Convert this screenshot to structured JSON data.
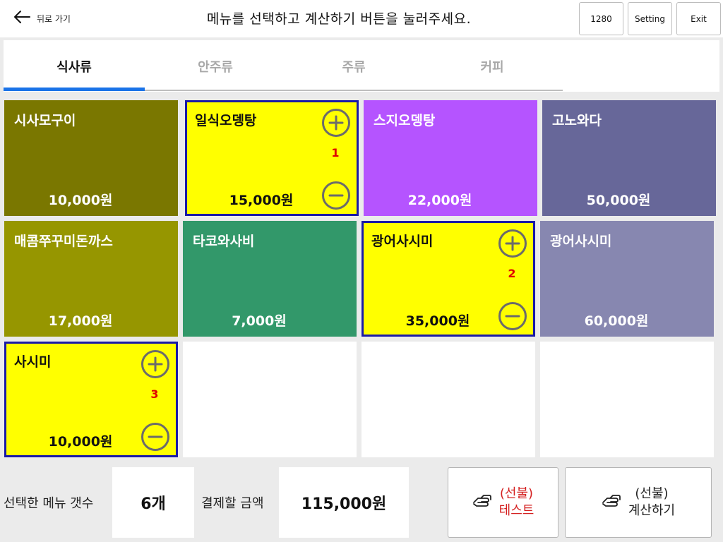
{
  "header": {
    "back_label": "뒤로 가기",
    "title": "메뉴를 선택하고 계산하기 버튼을 눌러주세요.",
    "resolution_button": "1280",
    "setting_button": "Setting",
    "exit_button": "Exit"
  },
  "tabs": [
    {
      "label": "식사류",
      "active": true
    },
    {
      "label": "안주류",
      "active": false
    },
    {
      "label": "주류",
      "active": false
    },
    {
      "label": "커피",
      "active": false
    }
  ],
  "menu": [
    {
      "name": "시사모구이",
      "price": "10,000원",
      "color": "#7a7700",
      "selected": false
    },
    {
      "name": "일식오뎅탕",
      "price": "15,000원",
      "color": "#ffff00",
      "selected": true,
      "qty": "1"
    },
    {
      "name": "스지오뎅탕",
      "price": "22,000원",
      "color": "#b554ff",
      "selected": false
    },
    {
      "name": "고노와다",
      "price": "50,000원",
      "color": "#676799",
      "selected": false
    },
    {
      "name": "매콤쭈꾸미돈까스",
      "price": "17,000원",
      "color": "#969600",
      "selected": false
    },
    {
      "name": "타코와사비",
      "price": "7,000원",
      "color": "#32986a",
      "selected": false
    },
    {
      "name": "광어사시미",
      "price": "35,000원",
      "color": "#ffff00",
      "selected": true,
      "qty": "2"
    },
    {
      "name": "광어사시미",
      "price": "60,000원",
      "color": "#8787b0",
      "selected": false
    },
    {
      "name": "사시미",
      "price": "10,000원",
      "color": "#ffff00",
      "selected": true,
      "qty": "3"
    }
  ],
  "footer": {
    "count_label": "선택한 메뉴 갯수",
    "count_value": "6개",
    "amount_label": "결제할 금액",
    "amount_value": "115,000원",
    "test_button_line1": "(선불)",
    "test_button_line2": "테스트",
    "checkout_button_line1": "(선불)",
    "checkout_button_line2": "계산하기"
  },
  "colors": {
    "accent": "#1a73e8",
    "selected_border": "#1a1aa6",
    "qty_text": "#e00000",
    "test_text": "#d42020"
  },
  "icons": {
    "back": "arrow-left-icon",
    "increase": "plus-circle-icon",
    "decrease": "minus-circle-icon",
    "pay": "hand-pay-icon"
  }
}
